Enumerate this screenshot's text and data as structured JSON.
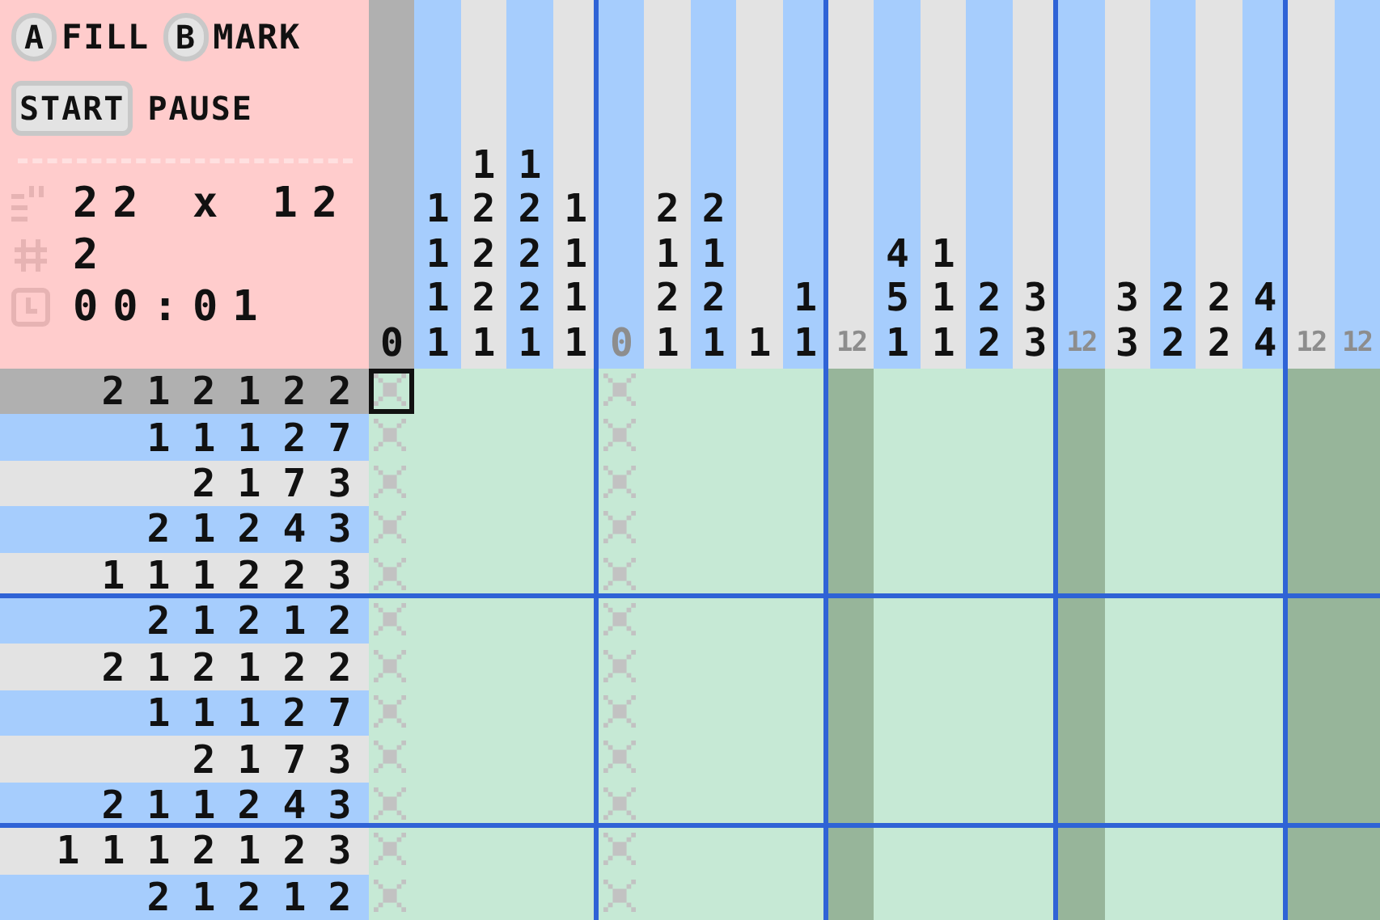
{
  "controls": [
    {
      "key": "A",
      "label": "FILL",
      "kind": "round"
    },
    {
      "key": "B",
      "label": "MARK",
      "kind": "round"
    }
  ],
  "mode_buttons": [
    {
      "label": "START",
      "selected": true
    },
    {
      "label": "PAUSE",
      "selected": false
    }
  ],
  "stats": [
    {
      "kind": "size",
      "value": "22 x 12"
    },
    {
      "kind": "count",
      "value": "2"
    },
    {
      "kind": "time",
      "value": "00:01"
    }
  ],
  "columns": [
    {
      "clues": [
        "0"
      ],
      "solved": false,
      "selected": true,
      "kind": "marked"
    },
    {
      "clues": [
        "1",
        "1",
        "1",
        "1"
      ],
      "solved": false,
      "selected": false,
      "kind": "empty"
    },
    {
      "clues": [
        "1",
        "2",
        "2",
        "2",
        "1"
      ],
      "solved": false,
      "selected": false,
      "kind": "empty"
    },
    {
      "clues": [
        "1",
        "2",
        "2",
        "2",
        "1"
      ],
      "solved": false,
      "selected": false,
      "kind": "empty"
    },
    {
      "clues": [
        "1",
        "1",
        "1",
        "1"
      ],
      "solved": false,
      "selected": false,
      "kind": "empty"
    },
    {
      "clues": [
        "0"
      ],
      "solved": true,
      "selected": false,
      "kind": "marked"
    },
    {
      "clues": [
        "2",
        "1",
        "2",
        "1"
      ],
      "solved": false,
      "selected": false,
      "kind": "empty"
    },
    {
      "clues": [
        "2",
        "1",
        "2",
        "1"
      ],
      "solved": false,
      "selected": false,
      "kind": "empty"
    },
    {
      "clues": [
        "1"
      ],
      "solved": false,
      "selected": false,
      "kind": "empty"
    },
    {
      "clues": [
        "1",
        "1"
      ],
      "solved": false,
      "selected": false,
      "kind": "empty"
    },
    {
      "clues": [
        "12"
      ],
      "solved": true,
      "selected": false,
      "kind": "filled"
    },
    {
      "clues": [
        "4",
        "5",
        "1"
      ],
      "solved": false,
      "selected": false,
      "kind": "empty"
    },
    {
      "clues": [
        "1",
        "1",
        "1"
      ],
      "solved": false,
      "selected": false,
      "kind": "empty"
    },
    {
      "clues": [
        "2",
        "2"
      ],
      "solved": false,
      "selected": false,
      "kind": "empty"
    },
    {
      "clues": [
        "3",
        "3"
      ],
      "solved": false,
      "selected": false,
      "kind": "empty"
    },
    {
      "clues": [
        "12"
      ],
      "solved": true,
      "selected": false,
      "kind": "filled"
    },
    {
      "clues": [
        "3",
        "3"
      ],
      "solved": false,
      "selected": false,
      "kind": "empty"
    },
    {
      "clues": [
        "2",
        "2"
      ],
      "solved": false,
      "selected": false,
      "kind": "empty"
    },
    {
      "clues": [
        "2",
        "2"
      ],
      "solved": false,
      "selected": false,
      "kind": "empty"
    },
    {
      "clues": [
        "4",
        "4"
      ],
      "solved": false,
      "selected": false,
      "kind": "empty"
    },
    {
      "clues": [
        "12"
      ],
      "solved": true,
      "selected": false,
      "kind": "filled"
    },
    {
      "clues": [
        "12"
      ],
      "solved": true,
      "selected": false,
      "kind": "filled"
    }
  ],
  "rows": [
    {
      "clues": [
        "2",
        "1",
        "2",
        "1",
        "2",
        "2"
      ],
      "selected": true
    },
    {
      "clues": [
        "1",
        "1",
        "1",
        "2",
        "7"
      ],
      "selected": false
    },
    {
      "clues": [
        "2",
        "1",
        "7",
        "3"
      ],
      "selected": false
    },
    {
      "clues": [
        "2",
        "1",
        "2",
        "4",
        "3"
      ],
      "selected": false
    },
    {
      "clues": [
        "1",
        "1",
        "1",
        "2",
        "2",
        "3"
      ],
      "selected": false
    },
    {
      "clues": [
        "2",
        "1",
        "2",
        "1",
        "2"
      ],
      "selected": false
    },
    {
      "clues": [
        "2",
        "1",
        "2",
        "1",
        "2",
        "2"
      ],
      "selected": false
    },
    {
      "clues": [
        "1",
        "1",
        "1",
        "2",
        "7"
      ],
      "selected": false
    },
    {
      "clues": [
        "2",
        "1",
        "7",
        "3"
      ],
      "selected": false
    },
    {
      "clues": [
        "2",
        "1",
        "1",
        "2",
        "4",
        "3"
      ],
      "selected": false
    },
    {
      "clues": [
        "1",
        "1",
        "1",
        "2",
        "1",
        "2",
        "3"
      ],
      "selected": false
    },
    {
      "clues": [
        "2",
        "1",
        "2",
        "1",
        "2"
      ],
      "selected": false
    }
  ]
}
